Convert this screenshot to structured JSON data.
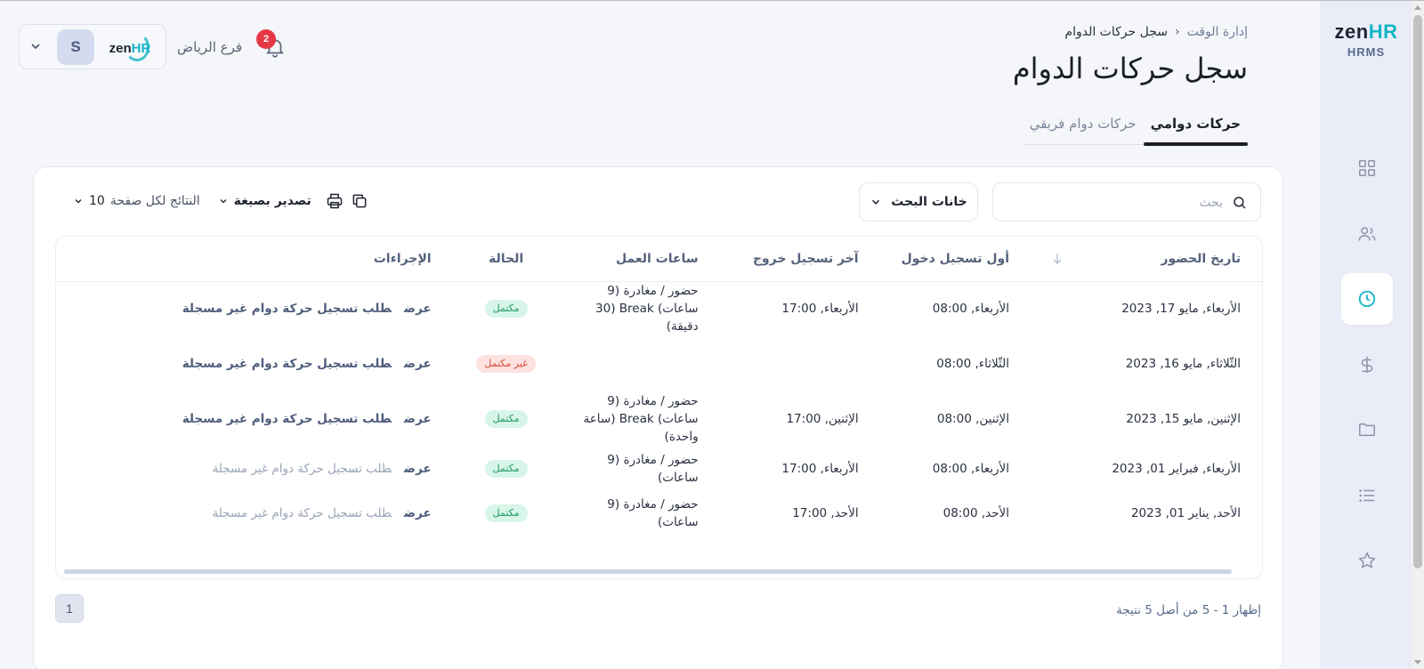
{
  "brand": {
    "name_prefix": "zen",
    "name_suffix": "HR",
    "subtitle": "HRMS"
  },
  "sidebar": {
    "items": [
      {
        "icon": "dashboard-grid-icon",
        "active": false
      },
      {
        "icon": "users-icon",
        "active": false
      },
      {
        "icon": "clock-icon",
        "active": true
      },
      {
        "icon": "dollar-icon",
        "active": false
      },
      {
        "icon": "folder-icon",
        "active": false
      },
      {
        "icon": "list-icon",
        "active": false
      },
      {
        "icon": "star-icon",
        "active": false
      }
    ]
  },
  "header": {
    "breadcrumb": {
      "parent": "إدارة الوقت",
      "current": "سجل حركات الدوام"
    },
    "title": "سجل حركات الدوام",
    "tabs": [
      {
        "label": "حركات دوامي",
        "active": true
      },
      {
        "label": "حركات دوام فريقي",
        "active": false
      }
    ]
  },
  "user": {
    "avatar_initial": "S",
    "company_logo_prefix": "zen",
    "company_logo_suffix": "HR",
    "branch": "فرع الرياض",
    "notifications_count": "2"
  },
  "toolbar": {
    "search_placeholder": "بحث",
    "search_value": "",
    "search_fields_label": "خانات البحث",
    "export_label": "تصدير بصيغة",
    "per_page_label": "النتائج لكل صفحة",
    "per_page_value": "10"
  },
  "table": {
    "headers": {
      "date": "تاريخ الحضور",
      "first_in": "أول تسجيل دخول",
      "last_out": "آخر تسجيل خروج",
      "hours": "ساعات العمل",
      "status": "الحالة",
      "actions": "الإجراءات"
    },
    "rows": [
      {
        "date": "الأربعاء, مايو 17, 2023",
        "first_in": "الأربعاء, 08:00",
        "last_out": "الأربعاء, 17:00",
        "hours": "حضور / مغادرة (9 ساعات) Break (30 دقيقة)",
        "status": "مكتمل",
        "status_type": "ok",
        "view": "عرض",
        "request": "طلب تسجيل حركة دوام غير مسجلة",
        "request_muted": false
      },
      {
        "date": "الثّلاثاء, مايو 16, 2023",
        "first_in": "الثّلاثاء, 08:00",
        "last_out": "",
        "hours": "",
        "status": "غير مكتمل",
        "status_type": "bad",
        "view": "عرض",
        "request": "طلب تسجيل حركة دوام غير مسجلة",
        "request_muted": false
      },
      {
        "date": "الإثنين, مايو 15, 2023",
        "first_in": "الإثنين, 08:00",
        "last_out": "الإثنين, 17:00",
        "hours": "حضور / مغادرة (9 ساعات) Break (ساعة واحدة)",
        "status": "مكتمل",
        "status_type": "ok",
        "view": "عرض",
        "request": "طلب تسجيل حركة دوام غير مسجلة",
        "request_muted": false
      },
      {
        "date": "الأربعاء, فبراير 01, 2023",
        "first_in": "الأربعاء, 08:00",
        "last_out": "الأربعاء, 17:00",
        "hours": "حضور / مغادرة (9 ساعات)",
        "status": "مكتمل",
        "status_type": "ok",
        "view": "عرض",
        "request": "طلب تسجيل حركة دوام غير مسجلة",
        "request_muted": true
      },
      {
        "date": "الأحد, يناير 01, 2023",
        "first_in": "الأحد, 08:00",
        "last_out": "الأحد, 17:00",
        "hours": "حضور / مغادرة (9 ساعات)",
        "status": "مكتمل",
        "status_type": "ok",
        "view": "عرض",
        "request": "طلب تسجيل حركة دوام غير مسجلة",
        "request_muted": true
      }
    ]
  },
  "pagination": {
    "summary": "إظهار 1 - 5 من أصل 5 نتيجة",
    "current_page": "1"
  },
  "colors": {
    "accent": "#13b5c4",
    "status_ok_bg": "#d7f5e8",
    "status_ok_text": "#219a67",
    "status_bad_bg": "#fde2e0",
    "status_bad_text": "#d9463b",
    "badge": "#e53845"
  }
}
